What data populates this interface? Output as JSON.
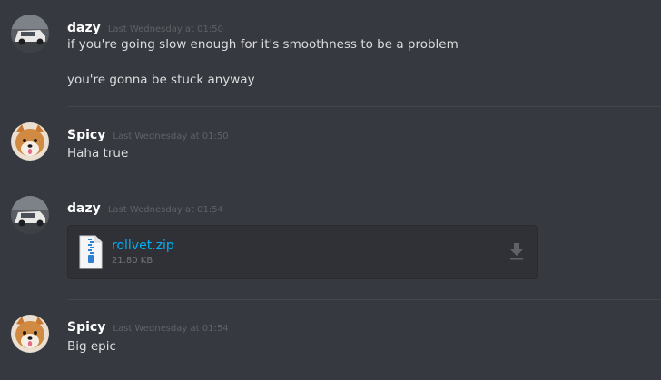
{
  "colors": {
    "background": "#36393f",
    "username": "#ffffff",
    "timestamp": "#5f6266",
    "message_text": "#dcddde",
    "link": "#00b0f4",
    "attachment_bg": "#2f3136"
  },
  "messages": [
    {
      "author": "dazy",
      "timestamp": "Last Wednesday at 01:50",
      "avatar_icon": "car-avatar-icon",
      "lines": [
        "if you're going slow enough for it's smoothness to be a problem",
        "you're gonna be stuck anyway"
      ]
    },
    {
      "author": "Spicy",
      "timestamp": "Last Wednesday at 01:50",
      "avatar_icon": "shiba-avatar-icon",
      "lines": [
        "Haha true"
      ]
    },
    {
      "author": "dazy",
      "timestamp": "Last Wednesday at 01:54",
      "avatar_icon": "car-avatar-icon",
      "attachment": {
        "file_icon": "zip-file-icon",
        "name": "rollvet.zip",
        "size": "21.80 KB",
        "download_icon": "download-icon"
      }
    },
    {
      "author": "Spicy",
      "timestamp": "Last Wednesday at 01:54",
      "avatar_icon": "shiba-avatar-icon",
      "lines": [
        "Big epic"
      ]
    }
  ]
}
